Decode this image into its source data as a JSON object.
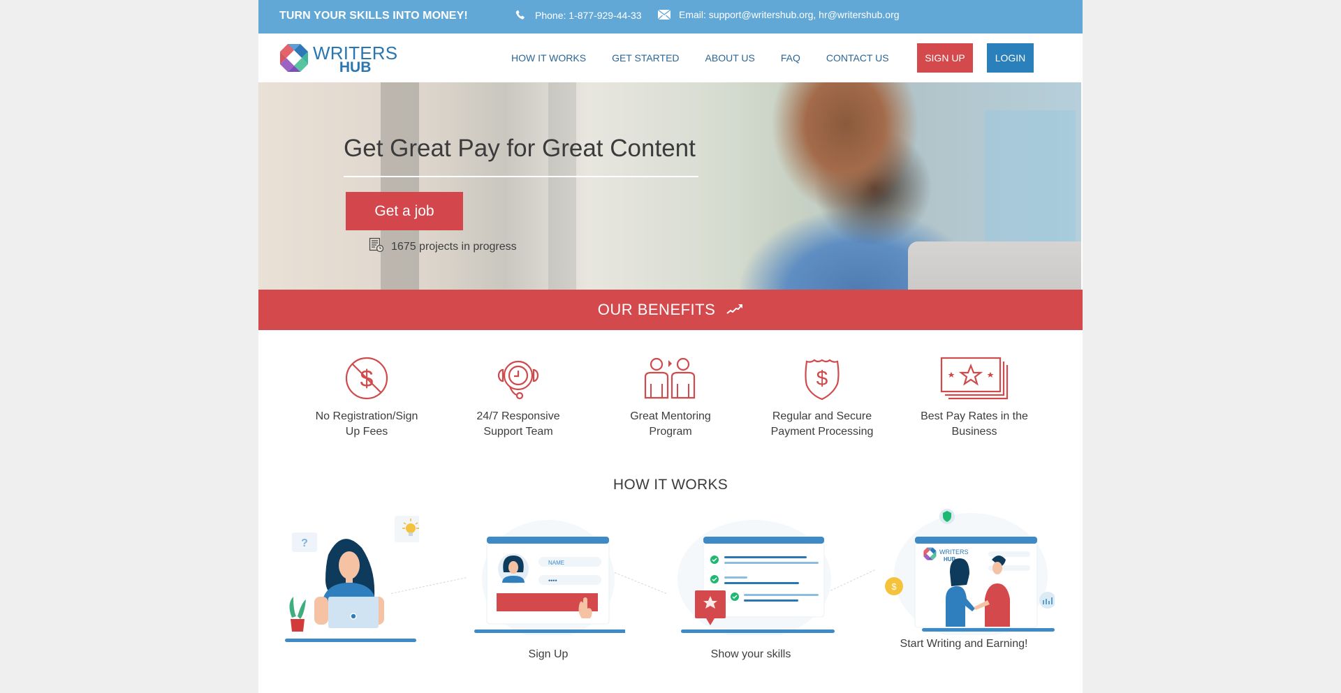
{
  "topbar": {
    "tagline": "TURN YOUR SKILLS INTO MONEY!",
    "phone_icon": "phone-icon",
    "phone": "Phone: 1-877-929-44-33",
    "email_icon": "envelope-icon",
    "email": "Email: support@writershub.org, hr@writershub.org"
  },
  "header": {
    "logo": {
      "line1": "WRITERS",
      "line2": "HUB",
      "icon": "octagon-logo-icon"
    },
    "nav": [
      {
        "label": "HOW IT WORKS"
      },
      {
        "label": "GET STARTED"
      },
      {
        "label": "ABOUT US"
      },
      {
        "label": "FAQ"
      },
      {
        "label": "CONTACT US"
      }
    ],
    "signup_label": "SIGN UP",
    "login_label": "LOGIN",
    "colors": {
      "signup": "#d3494c",
      "login": "#2a80bb",
      "nav_text": "#2a6596",
      "topbar": "#62a8d6"
    }
  },
  "hero": {
    "title": "Get Great Pay for Great Content",
    "cta_label": "Get a job",
    "projects_icon": "document-clock-icon",
    "projects_text": "1675 projects in progress"
  },
  "benefits": {
    "title": "OUR BENEFITS",
    "title_icon": "trending-up-icon",
    "items": [
      {
        "icon": "no-dollar-icon",
        "line1": "No Registration/Sign",
        "line2": "Up Fees"
      },
      {
        "icon": "support-headset-clock-icon",
        "line1": "24/7 Responsive",
        "line2": "Support Team"
      },
      {
        "icon": "mentoring-people-icon",
        "line1": "Great Mentoring",
        "line2": "Program"
      },
      {
        "icon": "shield-dollar-icon",
        "line1": "Regular and Secure",
        "line2": "Payment Processing"
      },
      {
        "icon": "banknotes-star-icon",
        "line1": "Best Pay Rates in the",
        "line2": "Business"
      }
    ],
    "accent": "#d3494c"
  },
  "how_it_works": {
    "title": "HOW IT WORKS",
    "steps": [
      {
        "illustration": "woman-at-laptop-illustration",
        "caption": ""
      },
      {
        "illustration": "signup-form-illustration",
        "caption": "Sign Up",
        "form_field": "NAME",
        "password_mask": "••••"
      },
      {
        "illustration": "skills-checklist-illustration",
        "caption": "Show your skills"
      },
      {
        "illustration": "handshake-illustration",
        "caption": "Start Writing and Earning!",
        "brand_line1": "WRITERS",
        "brand_line2": "HUB"
      }
    ]
  }
}
